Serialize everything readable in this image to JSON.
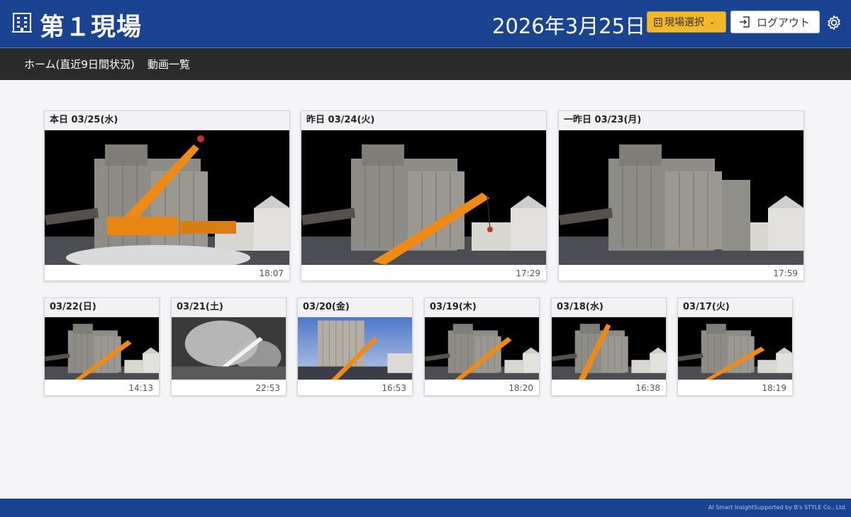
{
  "header": {
    "site_icon": "building-icon",
    "site_title": "第１現場",
    "date": "2026年3月25日",
    "site_select_label": "現場選択",
    "logout_label": "ログアウト",
    "colors": {
      "header_bg": "#1a4491",
      "select_bg": "#f3b72a",
      "nav_bg": "#2b2b2b"
    }
  },
  "nav": {
    "items": [
      {
        "label": "ホーム(直近9日間状況)"
      },
      {
        "label": "動画一覧"
      }
    ]
  },
  "recent": [
    {
      "title": "本日 03/25(水)",
      "time": "18:07"
    },
    {
      "title": "昨日 03/24(火)",
      "time": "17:29"
    },
    {
      "title": "一昨日 03/23(月)",
      "time": "17:59"
    }
  ],
  "older": [
    {
      "title": "03/22(日)",
      "time": "14:13"
    },
    {
      "title": "03/21(土)",
      "time": "22:53"
    },
    {
      "title": "03/20(金)",
      "time": "16:53"
    },
    {
      "title": "03/19(木)",
      "time": "18:20"
    },
    {
      "title": "03/18(水)",
      "time": "16:38"
    },
    {
      "title": "03/17(火)",
      "time": "18:19"
    }
  ],
  "footer": {
    "text": "AI Smart InsightSupported by B's STYLE Co., Ltd."
  }
}
